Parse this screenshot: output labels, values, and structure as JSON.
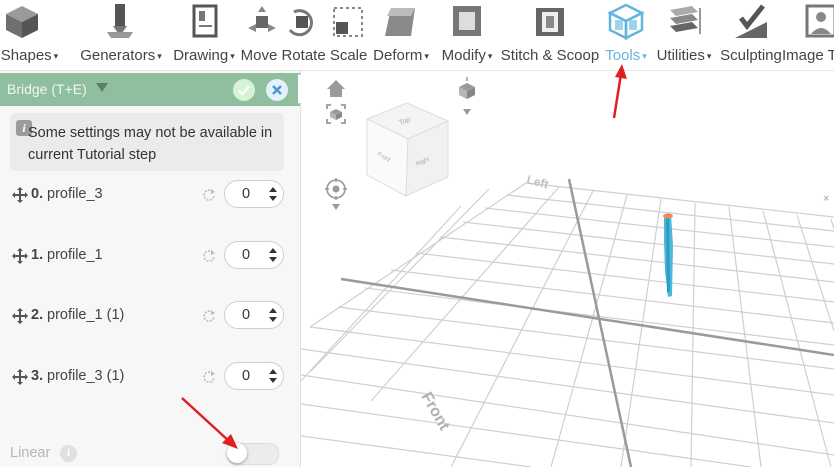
{
  "toolbar": {
    "items": [
      {
        "label": "D Shapes",
        "caret": "▾",
        "icon": "cube-icon"
      },
      {
        "label": "Generators",
        "caret": "▾",
        "icon": "generator-icon"
      },
      {
        "label": "Drawing",
        "caret": "▾",
        "icon": "drawing-icon"
      },
      {
        "label": "Move Rotate Scale",
        "caret": "",
        "icon": "move-rotate-scale-icon"
      },
      {
        "label": "Deform",
        "caret": "▾",
        "icon": "deform-icon"
      },
      {
        "label": "Modify",
        "caret": "▾",
        "icon": "modify-icon"
      },
      {
        "label": "Stitch & Scoop",
        "caret": "",
        "icon": "stitch-scoop-icon"
      },
      {
        "label": "Tools",
        "caret": "▾",
        "icon": "tools-icon",
        "active": true
      },
      {
        "label": "Utilities",
        "caret": "▾",
        "icon": "utilities-icon"
      },
      {
        "label": "Sculpting",
        "caret": "",
        "icon": "sculpting-icon"
      },
      {
        "label": "Image T",
        "caret": "",
        "icon": "image-icon"
      }
    ]
  },
  "panel": {
    "title": "Bridge (T+E)",
    "info_text": "Some settings may not be available in current Tutorial step",
    "profiles": [
      {
        "index": "0.",
        "name": "profile_3",
        "value": "0"
      },
      {
        "index": "1.",
        "name": "profile_1",
        "value": "0"
      },
      {
        "index": "2.",
        "name": "profile_1 (1)",
        "value": "0"
      },
      {
        "index": "3.",
        "name": "profile_3 (1)",
        "value": "0"
      }
    ],
    "linear_label": "Linear",
    "linear_enabled": false
  },
  "viewcube": {
    "top": "Top",
    "front": "Front",
    "left": "Right"
  },
  "scene": {
    "axis_label_back": "Left",
    "axis_label_front": "Front"
  },
  "colors": {
    "accent": "#64b5de",
    "panel_header": "#8fbf9f",
    "annotation_arrow": "#e02020",
    "object": "#4bb8dc"
  }
}
